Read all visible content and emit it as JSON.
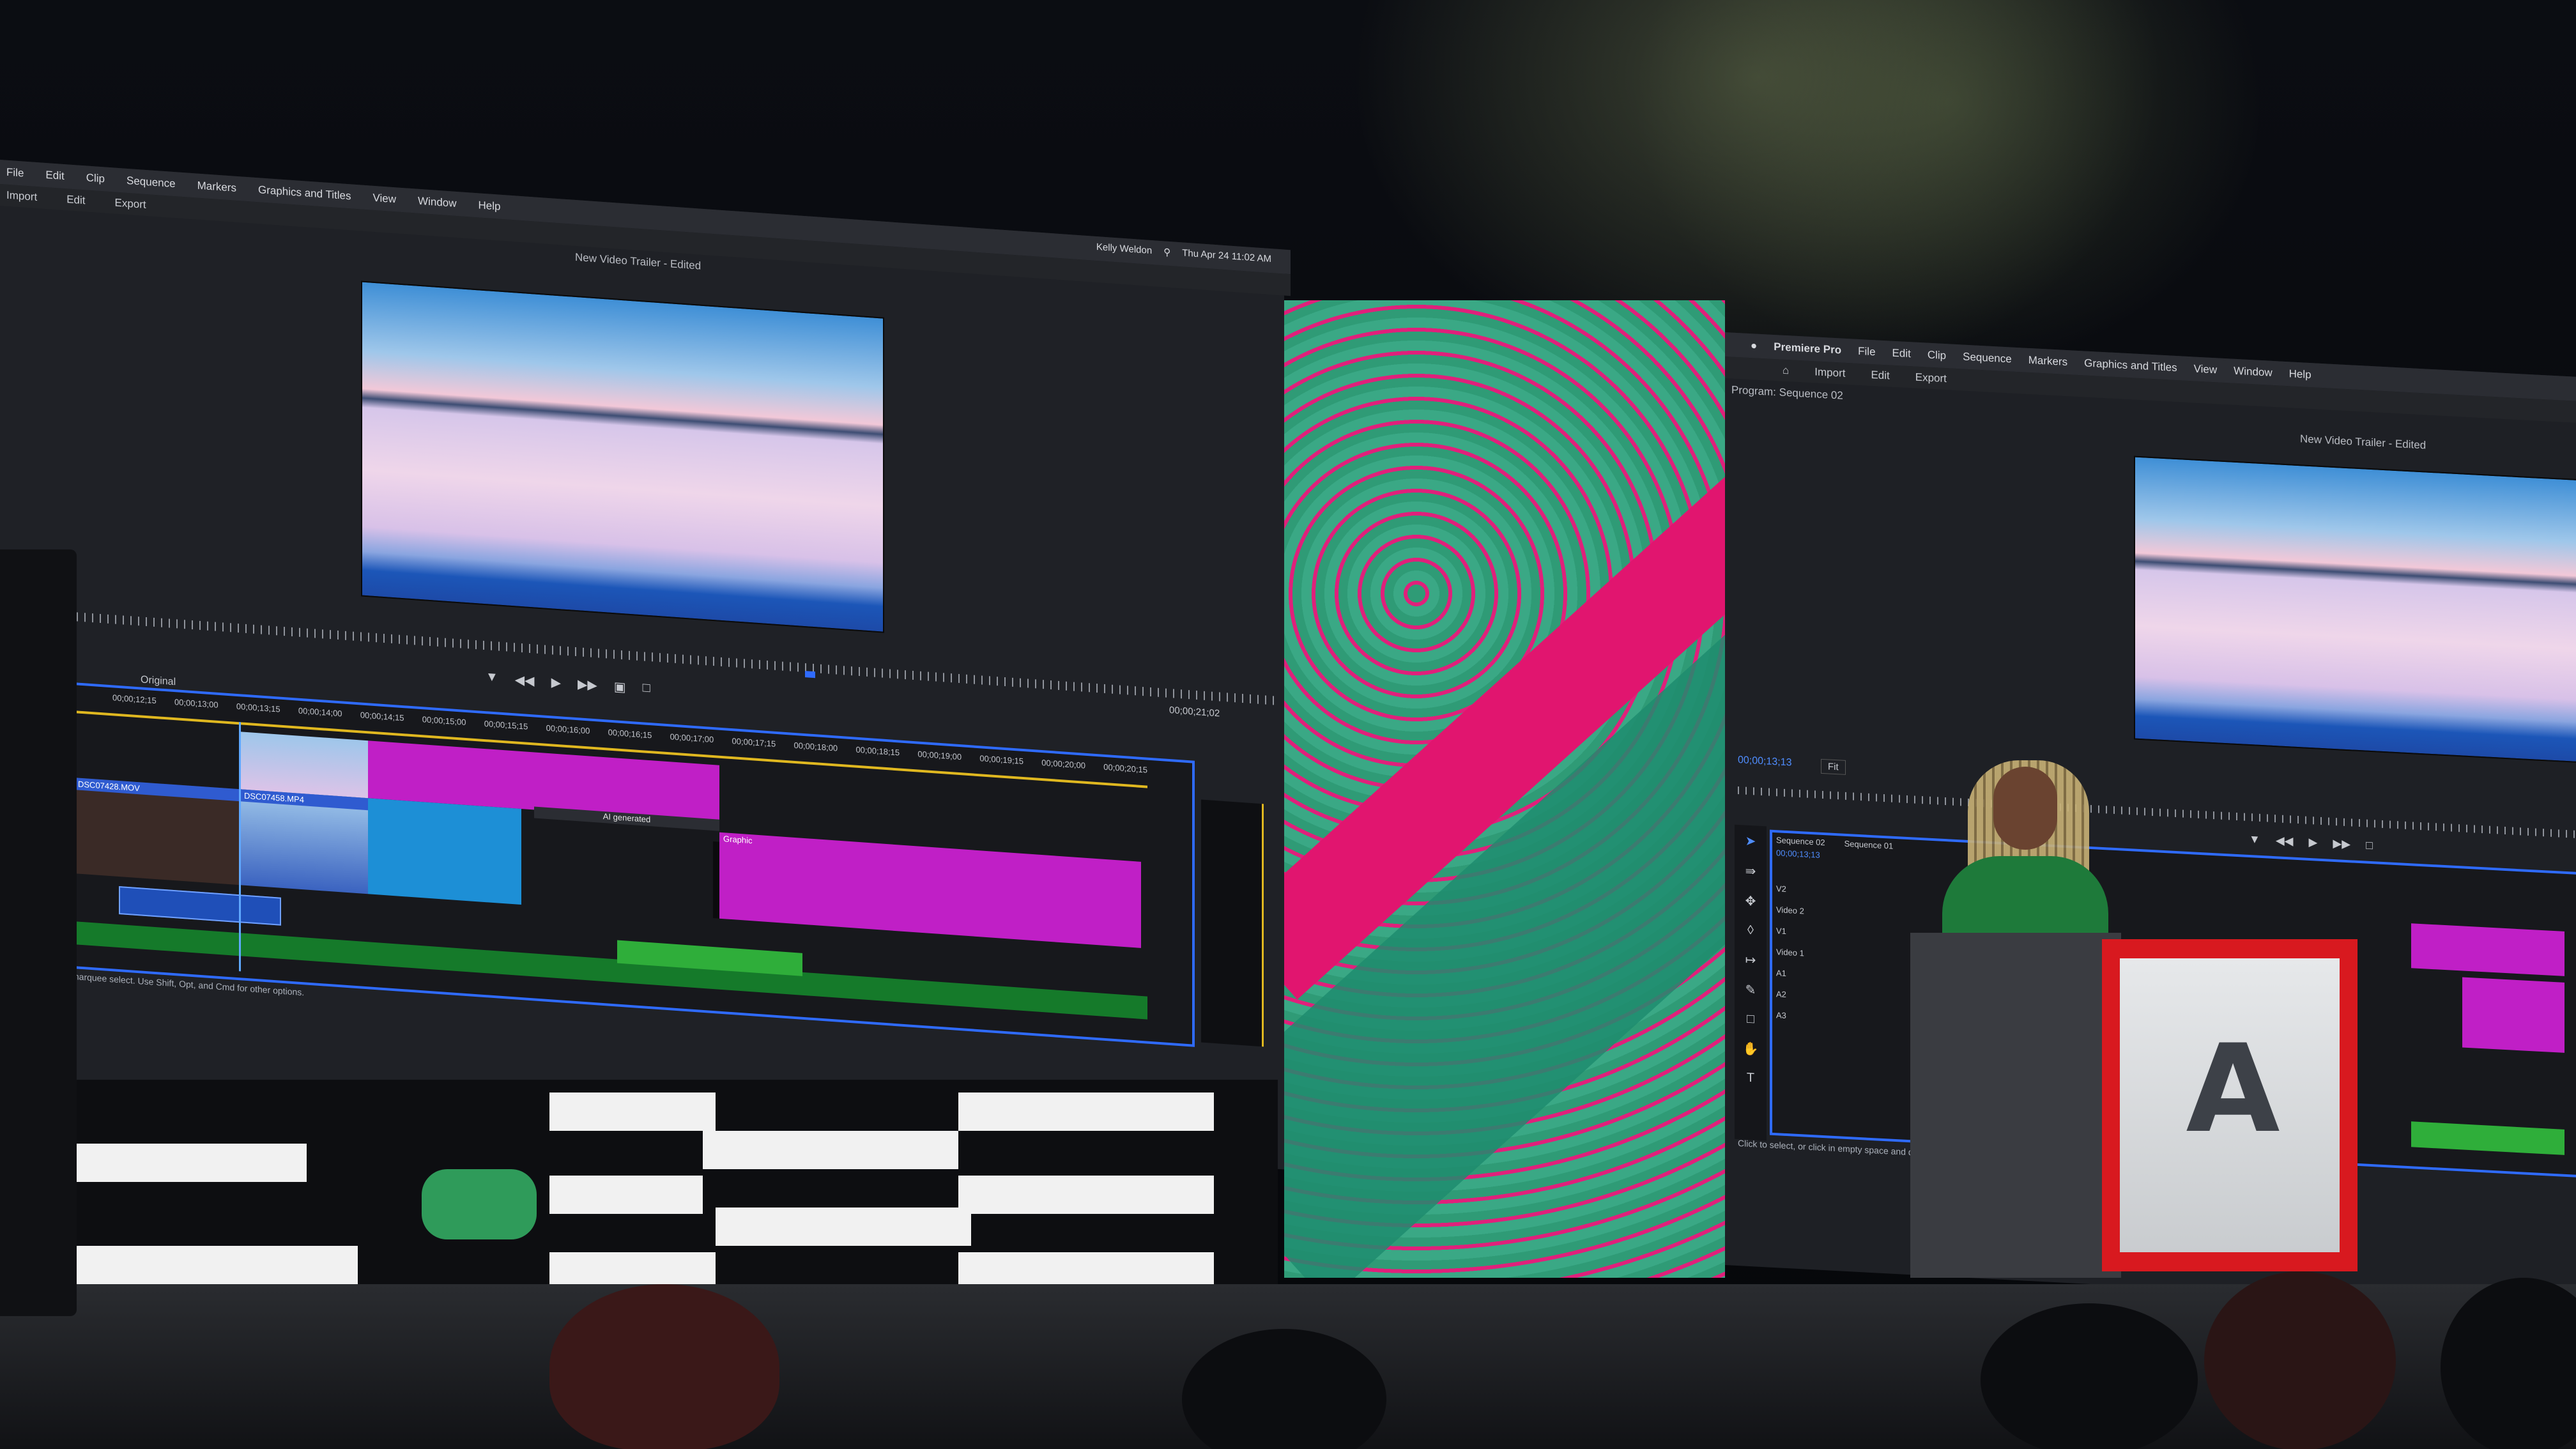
{
  "left_app": {
    "menu": [
      "File",
      "Edit",
      "Clip",
      "Sequence",
      "Markers",
      "Graphics and Titles",
      "View",
      "Window",
      "Help"
    ],
    "modes": [
      "Import",
      "Edit",
      "Export"
    ],
    "document_title": "New Video Trailer - Edited",
    "status": {
      "user": "Kelly Weldon",
      "clock": "Thu Apr 24 11:02 AM"
    },
    "timecode": "00;00;21;02",
    "track_label": "Original",
    "ruler": [
      "00;00;12;15",
      "00;00;13;00",
      "00;00;13;15",
      "00;00;14;00",
      "00;00;14;15",
      "00;00;15;00",
      "00;00;15;15",
      "00;00;16;00",
      "00;00;16;15",
      "00;00;17;00",
      "00;00;17;15",
      "00;00;18;00",
      "00;00;18;15",
      "00;00;19;00",
      "00;00;19;15",
      "00;00;20;00",
      "00;00;20;15"
    ],
    "clips": {
      "clip_a": "DSC07428.MOV",
      "clip_b": "DSC07458.MP4",
      "generated": "AI generated",
      "graphic": "Graphic"
    },
    "footer_hint": "marquee select. Use Shift, Opt, and Cmd for other options."
  },
  "right_app": {
    "menu": [
      "Premiere Pro",
      "File",
      "Edit",
      "Clip",
      "Sequence",
      "Markers",
      "Graphics and Titles",
      "View",
      "Window",
      "Help"
    ],
    "modes": [
      "Import",
      "Edit",
      "Export"
    ],
    "panel_title": "Program: Sequence 02",
    "document_title": "New Video Trailer - Edited",
    "timecode": "00;00;13;13",
    "zoom": "Fit",
    "sequence_tabs": [
      "Sequence 02",
      "Sequence 01"
    ],
    "tracks": [
      "V2",
      "Video 2",
      "V1",
      "Video 1",
      "A1",
      "A2",
      "A3"
    ],
    "footer_hint": "Click to select, or click in empty space and drag to"
  },
  "podium": {
    "logo_letter": "A"
  },
  "colors": {
    "timeline_border": "#2f6bff",
    "magenta_clip": "#c01fc6",
    "green_audio": "#2fae3a",
    "podium_red": "#d8191f"
  }
}
